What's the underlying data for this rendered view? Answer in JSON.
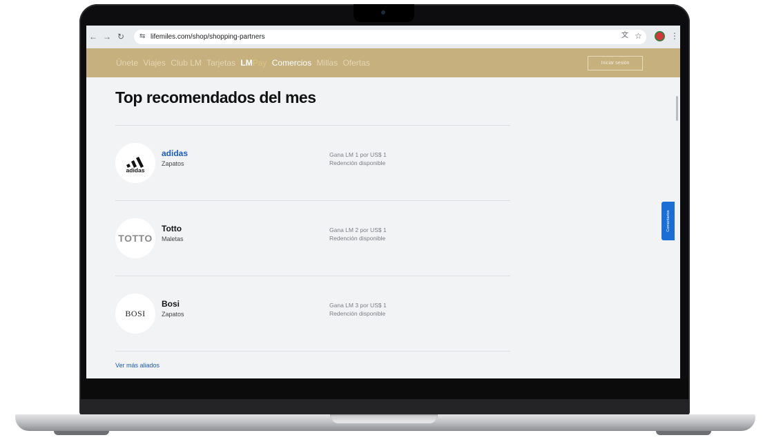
{
  "browser": {
    "url": "lifemiles.com/shop/shopping-partners"
  },
  "header": {
    "nav": [
      "Únete",
      "Viajes",
      "Club LM",
      "Tarjetas"
    ],
    "nav_lm": "LM",
    "nav_pay": "Pay",
    "nav_active": "Comercios",
    "nav_after": [
      "Millas",
      "Ofertas"
    ],
    "login_label": "Iniciar sesión"
  },
  "main": {
    "title": "Top recomendados del mes",
    "partners": [
      {
        "name": "adidas",
        "category": "Zapatos",
        "earn": "Gana LM 1 por US$ 1",
        "redeem": "Redención disponible",
        "logo_text": "adidas"
      },
      {
        "name": "Totto",
        "category": "Maletas",
        "earn": "Gana LM 2 por US$ 1",
        "redeem": "Redención disponible",
        "logo_text": "TOTTO"
      },
      {
        "name": "Bosi",
        "category": "Zapatos",
        "earn": "Gana LM 3 por US$ 1",
        "redeem": "Redención disponible",
        "logo_text": "BOSI"
      }
    ],
    "see_more": "Ver más aliados"
  },
  "feedback": {
    "label": "Comentarios"
  },
  "colors": {
    "header_bg": "#c5b07e",
    "link_blue": "#1a5bc4",
    "feedback_blue": "#1b6ed6"
  },
  "icons": [
    "back-arrow-icon",
    "forward-arrow-icon",
    "reload-icon",
    "site-settings-icon",
    "translate-icon",
    "bookmark-star-icon",
    "profile-icon",
    "menu-dots-icon",
    "adidas-logo-icon"
  ]
}
